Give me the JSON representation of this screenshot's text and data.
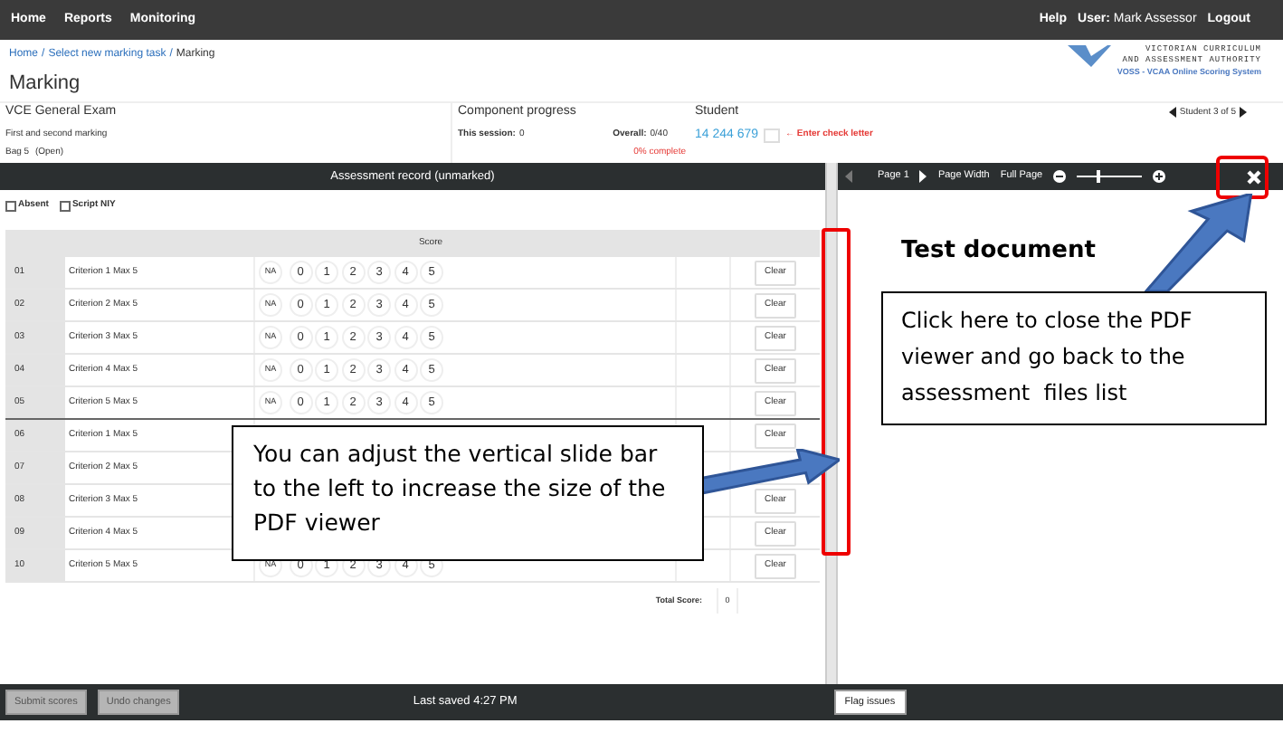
{
  "nav": {
    "links": [
      "Home",
      "Reports",
      "Monitoring"
    ],
    "help": "Help",
    "user_label": "User:",
    "user_name": "Mark Assessor",
    "logout": "Logout"
  },
  "breadcrumb": {
    "separator": "/",
    "items": [
      {
        "label": "Home",
        "link": true
      },
      {
        "label": "Select new marking task",
        "link": true
      },
      {
        "label": "Marking",
        "link": false
      }
    ]
  },
  "logo": {
    "line1": "VICTORIAN CURRICULUM",
    "line2": "AND ASSESSMENT AUTHORITY",
    "tagline": "VOSS - VCAA Online Scoring System"
  },
  "page_title": "Marking",
  "exam": {
    "title": "VCE General Exam",
    "marking": "First and second marking",
    "bag": "Bag 5",
    "bag_status": "(Open)"
  },
  "progress": {
    "title": "Component progress",
    "session_label": "This session:",
    "session_value": "0",
    "overall_label": "Overall:",
    "overall_value": "0/40",
    "percent": "0% complete"
  },
  "student": {
    "title": "Student",
    "number": "14 244 679",
    "check_hint": "← Enter check letter",
    "nav": "Student 3 of 5"
  },
  "record_title": "Assessment record (unmarked)",
  "checkboxes": [
    {
      "label": "Absent",
      "checked": false
    },
    {
      "label": "Script NIY",
      "checked": false
    }
  ],
  "table": {
    "score_header": "Score",
    "rows": [
      {
        "number": "01",
        "criterion": "Criterion 1 Max 5",
        "options": [
          "NA",
          "0",
          "1",
          "2",
          "3",
          "4",
          "5"
        ],
        "clear": "Clear"
      },
      {
        "number": "02",
        "criterion": "Criterion 2 Max 5",
        "options": [
          "NA",
          "0",
          "1",
          "2",
          "3",
          "4",
          "5"
        ],
        "clear": "Clear"
      },
      {
        "number": "03",
        "criterion": "Criterion 3 Max 5",
        "options": [
          "NA",
          "0",
          "1",
          "2",
          "3",
          "4",
          "5"
        ],
        "clear": "Clear"
      },
      {
        "number": "04",
        "criterion": "Criterion 4 Max 5",
        "options": [
          "NA",
          "0",
          "1",
          "2",
          "3",
          "4",
          "5"
        ],
        "clear": "Clear"
      },
      {
        "number": "05",
        "criterion": "Criterion 5 Max 5",
        "options": [
          "NA",
          "0",
          "1",
          "2",
          "3",
          "4",
          "5"
        ],
        "clear": "Clear"
      },
      {
        "number": "06",
        "criterion": "Criterion 1 Max 5",
        "clear": "Clear"
      },
      {
        "number": "07",
        "criterion": "Criterion 2 Max 5"
      },
      {
        "number": "08",
        "criterion": "Criterion 3 Max 5",
        "clear": "Clear"
      },
      {
        "number": "09",
        "criterion": "Criterion 4 Max 5",
        "clear": "Clear"
      },
      {
        "number": "10",
        "criterion": "Criterion 5 Max 5",
        "options": [
          "NA",
          "0",
          "1",
          "2",
          "3",
          "4",
          "5"
        ],
        "clear": "Clear"
      }
    ],
    "total_label": "Total Score:",
    "total_value": "0"
  },
  "pdf_toolbar": {
    "page": "Page 1",
    "page_width": "Page Width",
    "full_page": "Full Page",
    "zoom": {
      "level": 0.3
    }
  },
  "document_title": "Test document",
  "footer": {
    "buttons": [
      {
        "label": "Submit scores",
        "disabled": true
      },
      {
        "label": "Undo changes",
        "disabled": true
      }
    ],
    "last_saved": "Last saved 4:27 PM",
    "flag": "Flag issues"
  },
  "callouts": [
    {
      "text": "You can adjust the vertical slide bar to the left to increase the size of the PDF viewer"
    },
    {
      "text": "Click here to close the PDF viewer and go back to the assessment  files list"
    }
  ]
}
